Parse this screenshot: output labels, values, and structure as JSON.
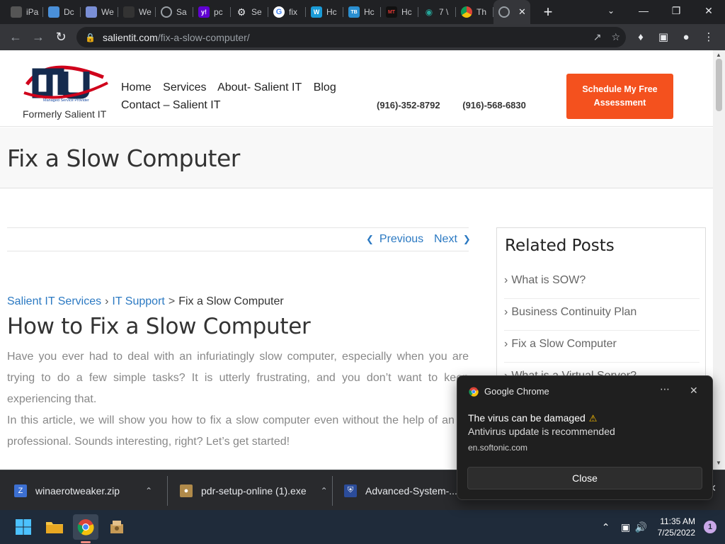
{
  "browser": {
    "tabs": [
      {
        "title": "iPa",
        "icon": "ipa-favicon",
        "color": "#555555"
      },
      {
        "title": "Dc",
        "icon": "doc-favicon",
        "color": "#4a90d9"
      },
      {
        "title": "We",
        "icon": "web-favicon",
        "color": "#7a8fd6"
      },
      {
        "title": "We",
        "icon": "web-dark-favicon",
        "color": "#333333"
      },
      {
        "title": "Sa",
        "icon": "globe-favicon",
        "color": "#9aa0a6"
      },
      {
        "title": "pc",
        "icon": "yahoo-favicon",
        "color": "#6001d2"
      },
      {
        "title": "Se",
        "icon": "settings-favicon",
        "color": "#e8eaed"
      },
      {
        "title": "fix",
        "icon": "google-favicon",
        "color": "#ffffff"
      },
      {
        "title": "Hc",
        "icon": "w-favicon",
        "color": "#1a9bd7"
      },
      {
        "title": "Hc",
        "icon": "tb-favicon",
        "color": "#2a8fd1"
      },
      {
        "title": "Hc",
        "icon": "mt-favicon",
        "color": "#c62828"
      },
      {
        "title": "7 \\",
        "icon": "eye-favicon",
        "color": "#26a69a"
      },
      {
        "title": "Th",
        "icon": "chrome-favicon",
        "color": "#e8eaed"
      },
      {
        "title": "",
        "icon": "globe-favicon",
        "color": "#9aa0a6",
        "active": true
      }
    ],
    "url_host": "salientit.com",
    "url_path": "/fix-a-slow-computer/"
  },
  "site": {
    "logo_tag": "Formerly Salient IT",
    "logo_sub": "Managed Service Provider",
    "nav": [
      "Home",
      "Services",
      "About- Salient IT",
      "Blog",
      "Contact – Salient IT"
    ],
    "phone1": "(916)-352-8792",
    "phone2": "(916)-568-6830",
    "cta": "Schedule My Free Assessment",
    "page_title": "Fix a Slow Computer",
    "prev": "Previous",
    "next": "Next",
    "breadcrumb": {
      "b1": "Salient IT Services",
      "b2": "IT Support",
      "b3": "Fix a Slow Computer"
    },
    "article_title": "How to Fix a Slow Computer",
    "para1": "Have you ever had to deal with an infuriatingly slow computer, especially when you are trying to do a few simple tasks? It is utterly frustrating, and you don’t want to keep experiencing that.",
    "para2": "In this article, we will show you how to fix a slow computer even without the help of an IT professional. Sounds interesting, right? Let’s get started!",
    "related_title": "Related Posts",
    "related": [
      "What is SOW?",
      "Business Continuity Plan",
      "Fix a Slow Computer",
      "What is a Virtual Server?"
    ]
  },
  "downloads": [
    {
      "name": "winaerotweaker.zip",
      "icon": "zip-icon"
    },
    {
      "name": "pdr-setup-online (1).exe",
      "icon": "installer-icon"
    },
    {
      "name": "Advanced-System-....exe",
      "icon": "shield-installer-icon"
    }
  ],
  "toast": {
    "app": "Google Chrome",
    "line1": "The virus can be damaged",
    "line2": "Antivirus update is recommended",
    "source": "en.softonic.com",
    "button": "Close"
  },
  "taskbar": {
    "time": "11:35 AM",
    "date": "7/25/2022",
    "notif_count": "1"
  }
}
